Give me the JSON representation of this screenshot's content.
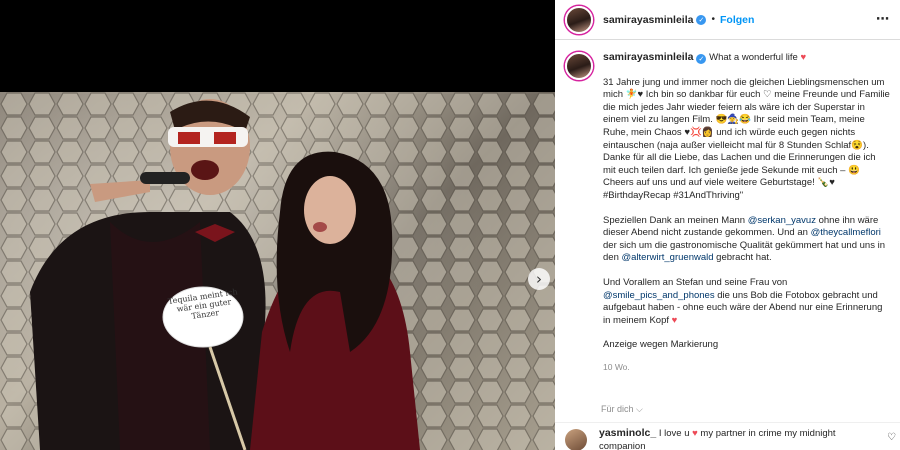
{
  "post": {
    "username": "samirayasminleila",
    "follow_label": "Folgen",
    "separator": "•",
    "more_icon": "⋯"
  },
  "caption": {
    "username": "samirayasminleila",
    "title": "What a wonderful life",
    "title_emoji": "♥",
    "paragraph1": "31 Jahre jung und immer noch die gleichen Lieblingsmenschen um mich 🧚♥ Ich bin so dankbar für euch ♡ meine Freunde und Familie die mich jedes Jahr wieder feiern als wäre ich der Superstar in einem viel zu langen Film. 😎🧙😂 Ihr seid mein Team, meine Ruhe, mein Chaos ♥💢👩 und ich würde euch gegen nichts eintauschen (naja außer vielleicht mal für 8 Stunden Schlaf😵). Danke für all die Liebe, das Lachen und die Erinnerungen die ich mit euch teilen darf. Ich genieße jede Sekunde mit euch – 😃 Cheers auf uns und auf viele weitere Geburtstage! 🍾♥ #BirthdayRecap #31AndThriving\"",
    "paragraph2_a": "Speziellen Dank an meinen Mann ",
    "mention_serkan": "@serkan_yavuz",
    "paragraph2_b": " ohne ihn wäre dieser Abend nicht zustande gekommen. Und an ",
    "mention_flori": "@theycallmeflori",
    "paragraph2_c": " der sich um die gastronomische Qualität gekümmert hat und uns in den ",
    "mention_alterwirt": "@alterwirt_gruenwald",
    "paragraph2_d": " gebracht hat.",
    "paragraph3_a": "Und Vorallem an Stefan und seine Frau von ",
    "mention_smile": "@smile_pics_and_phones",
    "paragraph3_b": " die uns Bob die Fotobox gebracht und aufgebaut haben - ohne euch wäre der Abend nur eine Erinnerung in meinem Kopf ",
    "paragraph3_emoji": "♥",
    "paragraph4": "Anzeige wegen Markierung",
    "timestamp": "10 Wo."
  },
  "see_translation": "Für dich ⌵",
  "comment": {
    "username": "yasminolc_",
    "text_a": " I love u ",
    "heart": "♥",
    "text_b": " my partner in crime my midnight companion"
  },
  "media": {
    "sign_text": "Tequila meint ich wär ein guter Tänzer",
    "next_icon": "›"
  },
  "colors": {
    "accent": "#0095f6",
    "verified": "#3897f0",
    "like": "#ed4956",
    "mention": "#00376b"
  }
}
